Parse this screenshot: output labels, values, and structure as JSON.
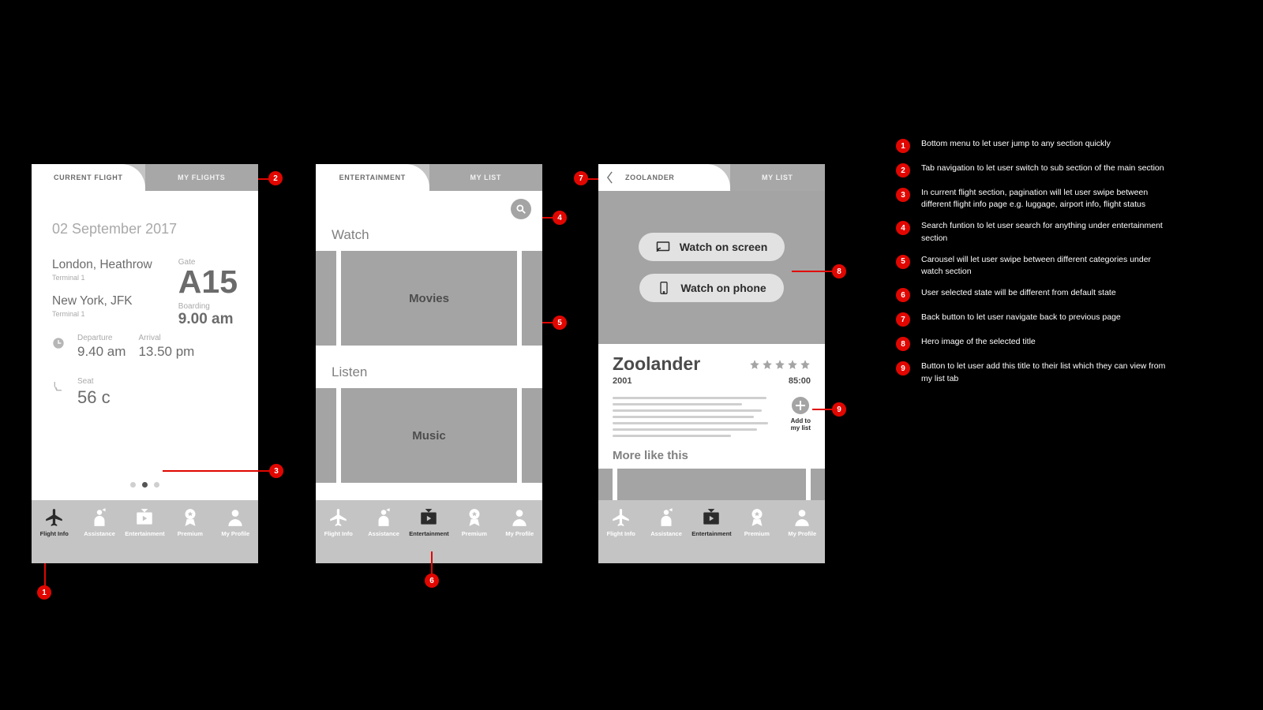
{
  "screens": {
    "s1": {
      "tabs": {
        "active": "CURRENT FLIGHT",
        "inactive": "MY FLIGHTS"
      },
      "date": "02 September 2017",
      "from_city": "London, Heathrow",
      "from_term": "Terminal 1",
      "to_city": "New York, JFK",
      "to_term": "Terminal 1",
      "gate_label": "Gate",
      "gate": "A15",
      "boarding_label": "Boarding",
      "boarding": "9.00 am",
      "dep_label": "Departure",
      "dep": "9.40 am",
      "arr_label": "Arrival",
      "arr": "13.50 pm",
      "seat_label": "Seat",
      "seat": "56 c"
    },
    "s2": {
      "tabs": {
        "active": "ENTERTAINMENT",
        "inactive": "MY LIST"
      },
      "watch_title": "Watch",
      "watch_card": "Movies",
      "listen_title": "Listen",
      "listen_card": "Music"
    },
    "s3": {
      "tabs": {
        "title": "ZOOLANDER",
        "inactive": "MY LIST"
      },
      "btn_screen": "Watch on screen",
      "btn_phone": "Watch on phone",
      "movie_title": "Zoolander",
      "year": "2001",
      "runtime": "85:00",
      "add_label": "Add to\nmy list",
      "more_title": "More like this"
    }
  },
  "nav": {
    "items": [
      {
        "label": "Flight Info"
      },
      {
        "label": "Assistance"
      },
      {
        "label": "Entertainment"
      },
      {
        "label": "Premium"
      },
      {
        "label": "My Profile"
      }
    ]
  },
  "annotations": [
    {
      "n": "1",
      "text": "Bottom menu to let user jump to any section quickly"
    },
    {
      "n": "2",
      "text": "Tab navigation to let user switch to sub section of the main section"
    },
    {
      "n": "3",
      "text": "In current flight section, pagination will let user swipe between different flight info page e.g. luggage, airport info, flight status"
    },
    {
      "n": "4",
      "text": "Search funtion to let user search for anything under entertainment section"
    },
    {
      "n": "5",
      "text": "Carousel will let user swipe between different categories under watch section"
    },
    {
      "n": "6",
      "text": "User selected state will be different from default state"
    },
    {
      "n": "7",
      "text": "Back button to let user navigate back to previous page"
    },
    {
      "n": "8",
      "text": "Hero image of the selected title"
    },
    {
      "n": "9",
      "text": "Button to let user add this title to their list which they can view from my list tab"
    }
  ]
}
